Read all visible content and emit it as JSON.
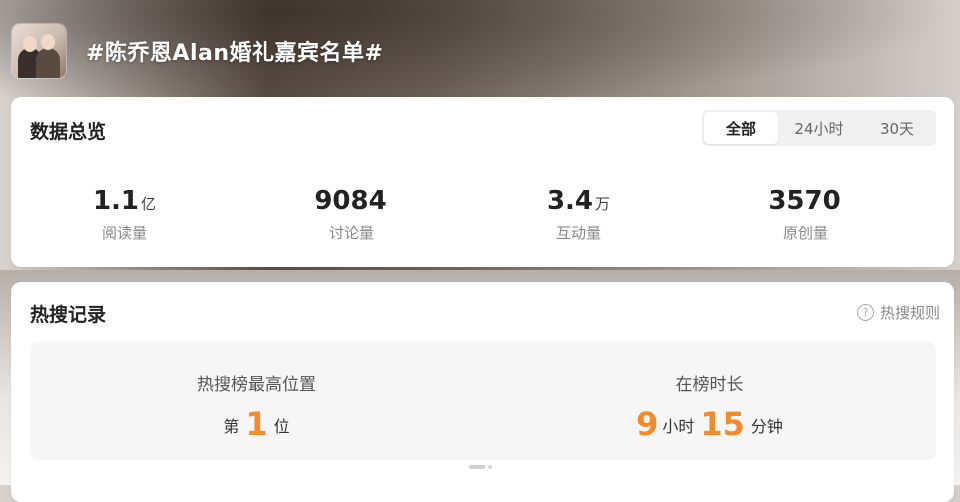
{
  "header": {
    "topic_title": "#陈乔恩Alan婚礼嘉宾名单#"
  },
  "overview": {
    "title": "数据总览",
    "tabs": [
      {
        "label": "全部",
        "active": true
      },
      {
        "label": "24小时",
        "active": false
      },
      {
        "label": "30天",
        "active": false
      }
    ],
    "stats": [
      {
        "value": "1.1",
        "unit": "亿",
        "label": "阅读量"
      },
      {
        "value": "9084",
        "unit": "",
        "label": "讨论量"
      },
      {
        "value": "3.4",
        "unit": "万",
        "label": "互动量"
      },
      {
        "value": "3570",
        "unit": "",
        "label": "原创量"
      }
    ]
  },
  "hot_search": {
    "title": "热搜记录",
    "rules_link": "热搜规则",
    "highest_position": {
      "label": "热搜榜最高位置",
      "prefix": "第",
      "value": "1",
      "suffix": "位"
    },
    "duration": {
      "label": "在榜时长",
      "hours": "9",
      "hours_unit": "小时",
      "minutes": "15",
      "minutes_unit": "分钟"
    }
  },
  "colors": {
    "accent_orange": "#f38a2c",
    "card_bg": "#ffffff",
    "muted_text": "#888888"
  },
  "icons": [
    "avatar-image",
    "question-circle-icon"
  ]
}
